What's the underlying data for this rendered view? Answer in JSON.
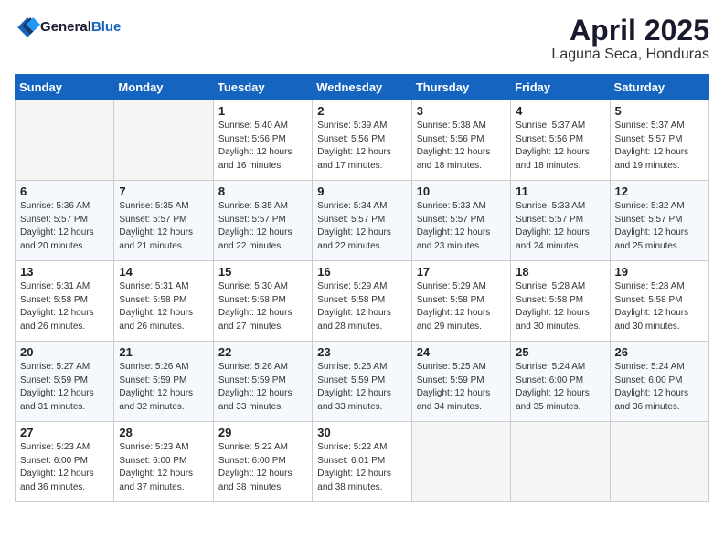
{
  "header": {
    "logo_general": "General",
    "logo_blue": "Blue",
    "title": "April 2025",
    "subtitle": "Laguna Seca, Honduras"
  },
  "days_of_week": [
    "Sunday",
    "Monday",
    "Tuesday",
    "Wednesday",
    "Thursday",
    "Friday",
    "Saturday"
  ],
  "weeks": [
    [
      {
        "day": "",
        "sunrise": "",
        "sunset": "",
        "daylight": ""
      },
      {
        "day": "",
        "sunrise": "",
        "sunset": "",
        "daylight": ""
      },
      {
        "day": "1",
        "sunrise": "Sunrise: 5:40 AM",
        "sunset": "Sunset: 5:56 PM",
        "daylight": "Daylight: 12 hours and 16 minutes."
      },
      {
        "day": "2",
        "sunrise": "Sunrise: 5:39 AM",
        "sunset": "Sunset: 5:56 PM",
        "daylight": "Daylight: 12 hours and 17 minutes."
      },
      {
        "day": "3",
        "sunrise": "Sunrise: 5:38 AM",
        "sunset": "Sunset: 5:56 PM",
        "daylight": "Daylight: 12 hours and 18 minutes."
      },
      {
        "day": "4",
        "sunrise": "Sunrise: 5:37 AM",
        "sunset": "Sunset: 5:56 PM",
        "daylight": "Daylight: 12 hours and 18 minutes."
      },
      {
        "day": "5",
        "sunrise": "Sunrise: 5:37 AM",
        "sunset": "Sunset: 5:57 PM",
        "daylight": "Daylight: 12 hours and 19 minutes."
      }
    ],
    [
      {
        "day": "6",
        "sunrise": "Sunrise: 5:36 AM",
        "sunset": "Sunset: 5:57 PM",
        "daylight": "Daylight: 12 hours and 20 minutes."
      },
      {
        "day": "7",
        "sunrise": "Sunrise: 5:35 AM",
        "sunset": "Sunset: 5:57 PM",
        "daylight": "Daylight: 12 hours and 21 minutes."
      },
      {
        "day": "8",
        "sunrise": "Sunrise: 5:35 AM",
        "sunset": "Sunset: 5:57 PM",
        "daylight": "Daylight: 12 hours and 22 minutes."
      },
      {
        "day": "9",
        "sunrise": "Sunrise: 5:34 AM",
        "sunset": "Sunset: 5:57 PM",
        "daylight": "Daylight: 12 hours and 22 minutes."
      },
      {
        "day": "10",
        "sunrise": "Sunrise: 5:33 AM",
        "sunset": "Sunset: 5:57 PM",
        "daylight": "Daylight: 12 hours and 23 minutes."
      },
      {
        "day": "11",
        "sunrise": "Sunrise: 5:33 AM",
        "sunset": "Sunset: 5:57 PM",
        "daylight": "Daylight: 12 hours and 24 minutes."
      },
      {
        "day": "12",
        "sunrise": "Sunrise: 5:32 AM",
        "sunset": "Sunset: 5:57 PM",
        "daylight": "Daylight: 12 hours and 25 minutes."
      }
    ],
    [
      {
        "day": "13",
        "sunrise": "Sunrise: 5:31 AM",
        "sunset": "Sunset: 5:58 PM",
        "daylight": "Daylight: 12 hours and 26 minutes."
      },
      {
        "day": "14",
        "sunrise": "Sunrise: 5:31 AM",
        "sunset": "Sunset: 5:58 PM",
        "daylight": "Daylight: 12 hours and 26 minutes."
      },
      {
        "day": "15",
        "sunrise": "Sunrise: 5:30 AM",
        "sunset": "Sunset: 5:58 PM",
        "daylight": "Daylight: 12 hours and 27 minutes."
      },
      {
        "day": "16",
        "sunrise": "Sunrise: 5:29 AM",
        "sunset": "Sunset: 5:58 PM",
        "daylight": "Daylight: 12 hours and 28 minutes."
      },
      {
        "day": "17",
        "sunrise": "Sunrise: 5:29 AM",
        "sunset": "Sunset: 5:58 PM",
        "daylight": "Daylight: 12 hours and 29 minutes."
      },
      {
        "day": "18",
        "sunrise": "Sunrise: 5:28 AM",
        "sunset": "Sunset: 5:58 PM",
        "daylight": "Daylight: 12 hours and 30 minutes."
      },
      {
        "day": "19",
        "sunrise": "Sunrise: 5:28 AM",
        "sunset": "Sunset: 5:58 PM",
        "daylight": "Daylight: 12 hours and 30 minutes."
      }
    ],
    [
      {
        "day": "20",
        "sunrise": "Sunrise: 5:27 AM",
        "sunset": "Sunset: 5:59 PM",
        "daylight": "Daylight: 12 hours and 31 minutes."
      },
      {
        "day": "21",
        "sunrise": "Sunrise: 5:26 AM",
        "sunset": "Sunset: 5:59 PM",
        "daylight": "Daylight: 12 hours and 32 minutes."
      },
      {
        "day": "22",
        "sunrise": "Sunrise: 5:26 AM",
        "sunset": "Sunset: 5:59 PM",
        "daylight": "Daylight: 12 hours and 33 minutes."
      },
      {
        "day": "23",
        "sunrise": "Sunrise: 5:25 AM",
        "sunset": "Sunset: 5:59 PM",
        "daylight": "Daylight: 12 hours and 33 minutes."
      },
      {
        "day": "24",
        "sunrise": "Sunrise: 5:25 AM",
        "sunset": "Sunset: 5:59 PM",
        "daylight": "Daylight: 12 hours and 34 minutes."
      },
      {
        "day": "25",
        "sunrise": "Sunrise: 5:24 AM",
        "sunset": "Sunset: 6:00 PM",
        "daylight": "Daylight: 12 hours and 35 minutes."
      },
      {
        "day": "26",
        "sunrise": "Sunrise: 5:24 AM",
        "sunset": "Sunset: 6:00 PM",
        "daylight": "Daylight: 12 hours and 36 minutes."
      }
    ],
    [
      {
        "day": "27",
        "sunrise": "Sunrise: 5:23 AM",
        "sunset": "Sunset: 6:00 PM",
        "daylight": "Daylight: 12 hours and 36 minutes."
      },
      {
        "day": "28",
        "sunrise": "Sunrise: 5:23 AM",
        "sunset": "Sunset: 6:00 PM",
        "daylight": "Daylight: 12 hours and 37 minutes."
      },
      {
        "day": "29",
        "sunrise": "Sunrise: 5:22 AM",
        "sunset": "Sunset: 6:00 PM",
        "daylight": "Daylight: 12 hours and 38 minutes."
      },
      {
        "day": "30",
        "sunrise": "Sunrise: 5:22 AM",
        "sunset": "Sunset: 6:01 PM",
        "daylight": "Daylight: 12 hours and 38 minutes."
      },
      {
        "day": "",
        "sunrise": "",
        "sunset": "",
        "daylight": ""
      },
      {
        "day": "",
        "sunrise": "",
        "sunset": "",
        "daylight": ""
      },
      {
        "day": "",
        "sunrise": "",
        "sunset": "",
        "daylight": ""
      }
    ]
  ]
}
